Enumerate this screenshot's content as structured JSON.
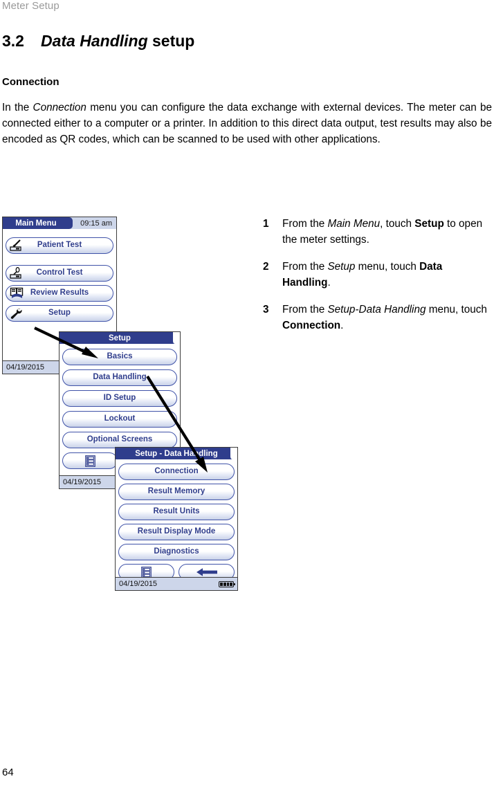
{
  "running_header": "Meter Setup",
  "section": {
    "number": "3.2",
    "title_italic": "Data Handling",
    "title_rest": "setup"
  },
  "sub_heading": "Connection",
  "body_paragraph": {
    "part1": "In the ",
    "italic1": "Connection",
    "part2": " menu you can configure the data exchange with external devices. The meter can be connected either to a computer or a printer. In addition to this direct data output, test results may also be encoded as QR codes, which can be scanned to be used with other applications."
  },
  "steps": [
    {
      "number": "1",
      "pre": "From the ",
      "italic": "Main Menu",
      "mid": ", touch ",
      "bold": "Setup",
      "post": " to open the meter settings."
    },
    {
      "number": "2",
      "pre": "From the ",
      "italic": "Setup",
      "mid": " menu, touch ",
      "bold": "Data Handling",
      "post": "."
    },
    {
      "number": "3",
      "pre": "From the ",
      "italic": "Setup-Data Handling",
      "mid": " menu, touch ",
      "bold": "Connection",
      "post": "."
    }
  ],
  "page_number": "64",
  "colors": {
    "title_bar": "#2f3d8c",
    "button_border": "#3f52a8",
    "button_text": "#2f3d8c",
    "status_bar": "#cdd6ea",
    "header_gray": "#9a9a9a"
  },
  "screens": {
    "main_menu": {
      "title": "Main Menu",
      "clock": "09:15 am",
      "date": "04/19/2015",
      "buttons": [
        {
          "label": "Patient Test",
          "icon": "lancet-strip-icon"
        },
        {
          "label": "Control Test",
          "icon": "control-solution-icon"
        },
        {
          "label": "Review Results",
          "icon": "review-book-icon"
        },
        {
          "label": "Setup",
          "icon": "wrench-icon"
        }
      ]
    },
    "setup": {
      "title": "Setup",
      "date": "04/19/2015",
      "buttons": [
        {
          "label": "Basics"
        },
        {
          "label": "Data Handling"
        },
        {
          "label": "ID Setup"
        },
        {
          "label": "Lockout"
        },
        {
          "label": "Optional Screens"
        }
      ],
      "footer_buttons": [
        {
          "icon": "list-menu-icon"
        }
      ]
    },
    "data_handling": {
      "title": "Setup - Data Handling",
      "date": "04/19/2015",
      "battery": "battery-full-icon",
      "buttons": [
        {
          "label": "Connection"
        },
        {
          "label": "Result Memory"
        },
        {
          "label": "Result Units"
        },
        {
          "label": "Result Display Mode"
        },
        {
          "label": "Diagnostics"
        }
      ],
      "footer_buttons": [
        {
          "icon": "list-menu-icon"
        },
        {
          "icon": "back-arrow-icon"
        }
      ]
    }
  }
}
